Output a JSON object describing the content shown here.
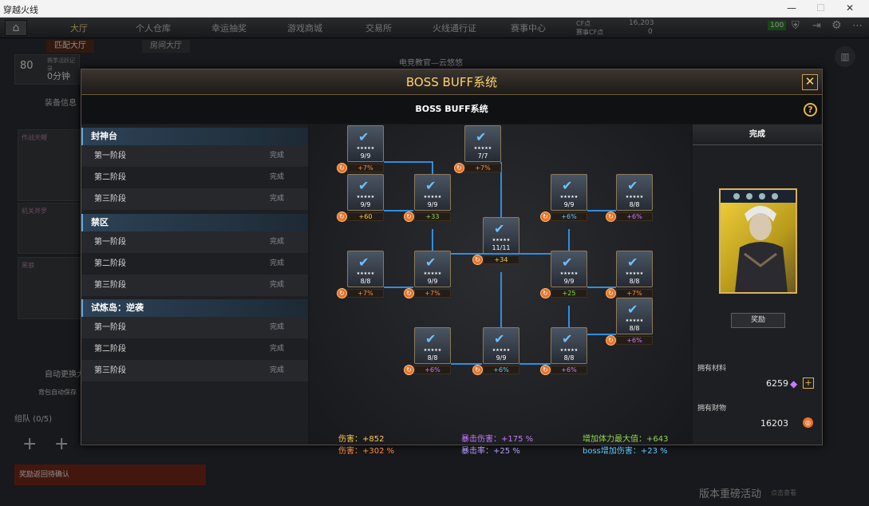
{
  "window": {
    "title": "穿越火线"
  },
  "topnav": {
    "items": [
      "大厅",
      "个人仓库",
      "幸运抽奖",
      "游戏商城",
      "交易所",
      "火线通行证",
      "赛事中心"
    ],
    "cf_label": "CF点",
    "cf_value": "16,203",
    "match_cf_label": "赛事CF点",
    "match_cf_value": "0",
    "sub_tabs": [
      "匹配大厅",
      "房间大厅"
    ],
    "level": "80",
    "ping": "100"
  },
  "background": {
    "banner": "电竞教官—云悠悠",
    "record_label": "赛季活跃记录",
    "score": "0分钟",
    "equip_info": "装备信息",
    "weapons": [
      "作战天鲤",
      "机关斧罗",
      "黑狼"
    ],
    "auto_exchange": "自动更换大",
    "team": "组队 (0/5)",
    "chat_notice": "奖励返回待确认",
    "event": "版本重磅活动",
    "event_sub": "点击查看",
    "bag_auto": "背包自动保存"
  },
  "dialog": {
    "title": "BOSS BUFF系统",
    "subtitle": "BOSS BUFF系统",
    "help": "?",
    "close": "✕"
  },
  "sidebar": {
    "sections": [
      {
        "name": "封神台",
        "stages": [
          {
            "label": "第一阶段",
            "status": "完成"
          },
          {
            "label": "第二阶段",
            "status": "完成"
          },
          {
            "label": "第三阶段",
            "status": "完成"
          }
        ]
      },
      {
        "name": "禁区",
        "stages": [
          {
            "label": "第一阶段",
            "status": "完成"
          },
          {
            "label": "第二阶段",
            "status": "完成"
          },
          {
            "label": "第三阶段",
            "status": "完成"
          }
        ]
      },
      {
        "name": "试炼岛：逆袭",
        "stages": [
          {
            "label": "第一阶段",
            "status": "完成"
          },
          {
            "label": "第二阶段",
            "status": "完成"
          },
          {
            "label": "第三阶段",
            "status": "完成"
          }
        ]
      }
    ]
  },
  "tree": {
    "nodes": [
      {
        "count": "9/9",
        "bonus": "+7%",
        "color": "#ff8a3c"
      },
      {
        "count": "7/7",
        "bonus": "+7%",
        "color": "#ff8a3c"
      },
      {
        "count": "9/9",
        "bonus": "+60",
        "color": "#ffcc4a"
      },
      {
        "count": "9/9",
        "bonus": "+33",
        "color": "#8fd84a"
      },
      {
        "count": "9/9",
        "bonus": "+6%",
        "color": "#5cc8ff"
      },
      {
        "count": "8/8",
        "bonus": "+6%",
        "color": "#c77bff"
      },
      {
        "count": "11/11",
        "bonus": "+34",
        "color": "#ffcc4a"
      },
      {
        "count": "8/8",
        "bonus": "+7%",
        "color": "#ff8a3c"
      },
      {
        "count": "9/9",
        "bonus": "+7%",
        "color": "#ff8a3c"
      },
      {
        "count": "9/9",
        "bonus": "+25",
        "color": "#8fd84a"
      },
      {
        "count": "8/8",
        "bonus": "+7%",
        "color": "#ff8a3c"
      },
      {
        "count": "8/8",
        "bonus": "+6%",
        "color": "#c77bff"
      },
      {
        "count": "8/8",
        "bonus": "+6%",
        "color": "#c77bff"
      },
      {
        "count": "9/9",
        "bonus": "+6%",
        "color": "#5cc8ff"
      },
      {
        "count": "8/8",
        "bonus": "+6%",
        "color": "#c77bff"
      }
    ]
  },
  "stats": [
    {
      "label": "伤害：+852",
      "color": "#ffcc4a"
    },
    {
      "label": "暴击伤害：+175 %",
      "color": "#c77bff"
    },
    {
      "label": "增加体力最大值：+643",
      "color": "#8fd84a"
    },
    {
      "label": "伤害：+302 %",
      "color": "#ff8a3c"
    },
    {
      "label": "暴击率：+25 %",
      "color": "#b79bff"
    },
    {
      "label": "boss增加伤害：+23 %",
      "color": "#5cc8ff"
    }
  ],
  "right": {
    "tab": "完成",
    "reward_button": "奖励",
    "materials_label": "拥有材料",
    "materials_value": "6259",
    "wealth_label": "拥有财物",
    "wealth_value": "16203"
  }
}
